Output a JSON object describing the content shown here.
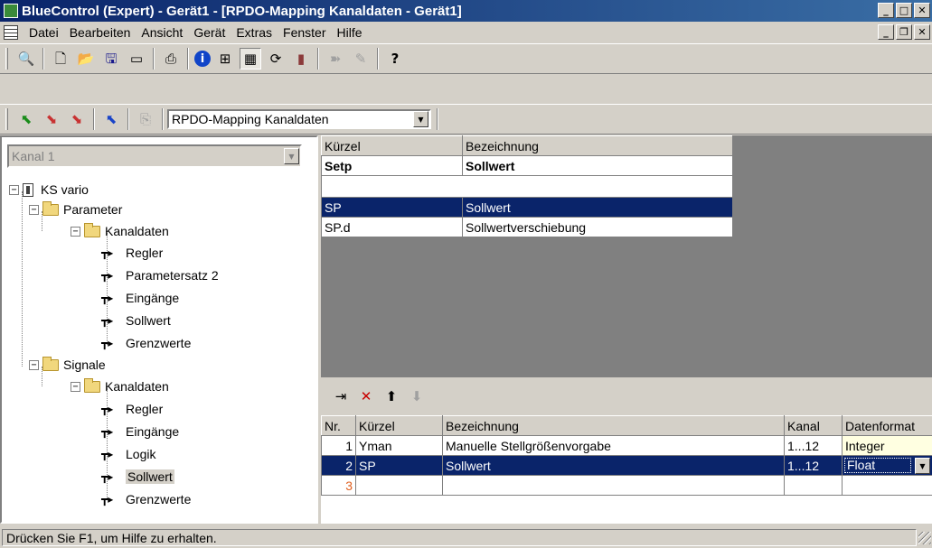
{
  "window": {
    "title": "BlueControl (Expert) - Gerät1 - [RPDO-Mapping Kanaldaten - Gerät1]"
  },
  "menu": [
    {
      "label": "Datei"
    },
    {
      "label": "Bearbeiten"
    },
    {
      "label": "Ansicht"
    },
    {
      "label": "Gerät"
    },
    {
      "label": "Extras"
    },
    {
      "label": "Fenster"
    },
    {
      "label": "Hilfe"
    }
  ],
  "toolbar2": {
    "view_select": "RPDO-Mapping Kanaldaten"
  },
  "tree": {
    "channel_select": "Kanal 1",
    "root": "KS vario",
    "parameter": "Parameter",
    "parameter_kanaldaten": "Kanaldaten",
    "parameter_items": [
      "Regler",
      "Parametersatz 2",
      "Eingänge",
      "Sollwert",
      "Grenzwerte"
    ],
    "signale": "Signale",
    "signale_kanaldaten": "Kanaldaten",
    "signale_items": [
      "Regler",
      "Eingänge",
      "Logik",
      "Sollwert",
      "Grenzwerte"
    ]
  },
  "top_grid": {
    "headers": [
      "Kürzel",
      "Bezeichnung"
    ],
    "group": {
      "code": "Setp",
      "name": "Sollwert"
    },
    "rows": [
      {
        "code": "SP",
        "name": "Sollwert"
      },
      {
        "code": "SP.d",
        "name": "Sollwertverschiebung"
      }
    ]
  },
  "mapping_grid": {
    "headers": [
      "Nr.",
      "Kürzel",
      "Bezeichnung",
      "Kanal",
      "Datenformat"
    ],
    "rows": [
      {
        "nr": "1",
        "code": "Yman",
        "name": "Manuelle Stellgrößenvorgabe",
        "kanal": "1...12",
        "format": "Integer"
      },
      {
        "nr": "2",
        "code": "SP",
        "name": "Sollwert",
        "kanal": "1...12",
        "format": "Float"
      }
    ],
    "new_row_nr": "3"
  },
  "status": {
    "text": "Drücken Sie F1, um Hilfe zu erhalten."
  },
  "colors": {
    "title_start": "#0a246a",
    "title_end": "#3a6ea5",
    "selection": "#0a246a",
    "integer_cell": "#ffffe1",
    "mdi_background": "#808080"
  }
}
